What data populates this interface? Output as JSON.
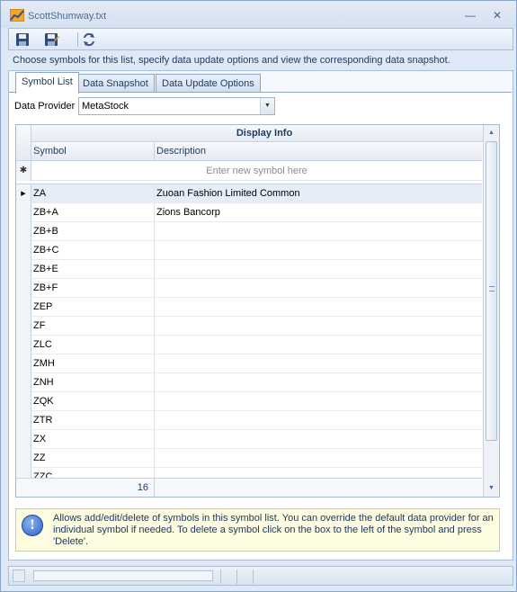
{
  "window": {
    "title": "ScottShumway.txt",
    "minimize_label": "—",
    "close_label": "✕"
  },
  "toolbar": {
    "icons": [
      "save-icon",
      "save-as-icon",
      "refresh-icon"
    ]
  },
  "instruction": "Choose symbols for this list, specify data update options and view the corresponding data snapshot.",
  "tabs": [
    {
      "label": "Symbol List",
      "active": true
    },
    {
      "label": "Data Snapshot",
      "active": false
    },
    {
      "label": "Data Update Options",
      "active": false
    }
  ],
  "data_provider": {
    "label": "Data Provider",
    "value": "MetaStock"
  },
  "grid": {
    "band_header": "Display Info",
    "columns": [
      "Symbol",
      "Description"
    ],
    "new_row_placeholder": "Enter new symbol here",
    "new_row_glyph": "✱",
    "rows": [
      {
        "symbol": "ZA",
        "description": "Zuoan Fashion Limited Common",
        "selected": true
      },
      {
        "symbol": "ZB+A",
        "description": "Zions Bancorp"
      },
      {
        "symbol": "ZB+B",
        "description": ""
      },
      {
        "symbol": "ZB+C",
        "description": ""
      },
      {
        "symbol": "ZB+E",
        "description": ""
      },
      {
        "symbol": "ZB+F",
        "description": ""
      },
      {
        "symbol": "ZEP",
        "description": ""
      },
      {
        "symbol": "ZF",
        "description": ""
      },
      {
        "symbol": "ZLC",
        "description": ""
      },
      {
        "symbol": "ZMH",
        "description": ""
      },
      {
        "symbol": "ZNH",
        "description": ""
      },
      {
        "symbol": "ZQK",
        "description": ""
      },
      {
        "symbol": "ZTR",
        "description": ""
      },
      {
        "symbol": "ZX",
        "description": ""
      },
      {
        "symbol": "ZZ",
        "description": ""
      },
      {
        "symbol": "ZZC",
        "description": ""
      }
    ],
    "footer_count": "16"
  },
  "info": {
    "text": "Allows add/edit/delete of symbols in this symbol list. You can override the default data provider for an individual symbol if needed. To delete a symbol click on the box to the left of the symbol and press 'Delete'."
  },
  "colors": {
    "accent": "#1e395b",
    "selected_row": "#e4edf8",
    "info_bg": "#fdfbe0"
  }
}
